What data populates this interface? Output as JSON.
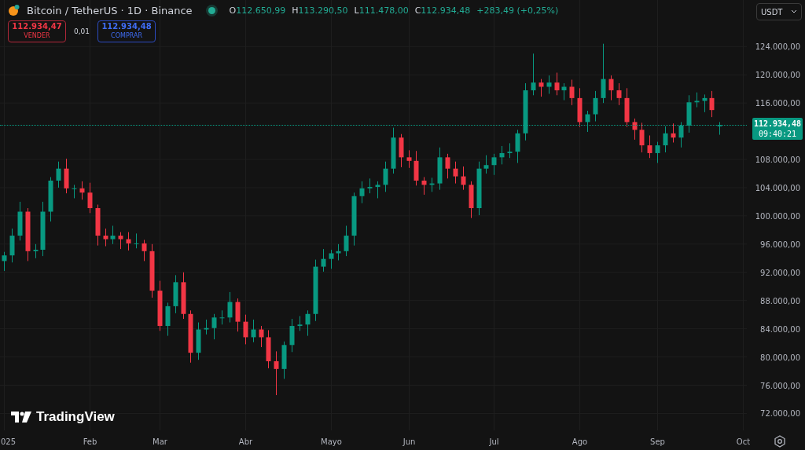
{
  "legend": {
    "title": "Bitcoin / TetherUS · 1D · Binance",
    "market_open": true,
    "ohlc": [
      {
        "label": "O",
        "value": "112.650,99"
      },
      {
        "label": "H",
        "value": "113.290,50"
      },
      {
        "label": "L",
        "value": "111.478,00"
      },
      {
        "label": "C",
        "value": "112.934,48"
      }
    ],
    "change": "+283,49 (+0,25%)"
  },
  "trade": {
    "sell": {
      "price": "112.934,47",
      "label": "VENDER"
    },
    "spread": "0,01",
    "buy": {
      "price": "112.934,48",
      "label": "COMPRAR"
    }
  },
  "currency": "USDT",
  "last_price": {
    "price": "112.934,48",
    "countdown": "09:40:21"
  },
  "logo": "TradingView",
  "chart_data": {
    "type": "candlestick",
    "grid": true,
    "ylim": [
      69600,
      130600
    ],
    "categories": [
      "025",
      null,
      null,
      null,
      null,
      null,
      null,
      null,
      null,
      null,
      null,
      "Feb",
      null,
      null,
      null,
      null,
      null,
      null,
      null,
      null,
      "Mar",
      null,
      null,
      null,
      null,
      null,
      null,
      null,
      null,
      null,
      null,
      "Abr",
      null,
      null,
      null,
      null,
      null,
      null,
      null,
      null,
      null,
      null,
      "Mayo",
      null,
      null,
      null,
      null,
      null,
      null,
      null,
      null,
      null,
      "Jun",
      null,
      null,
      null,
      null,
      null,
      null,
      null,
      null,
      null,
      null,
      "Jul",
      null,
      null,
      null,
      null,
      null,
      null,
      null,
      null,
      null,
      null,
      "Ago",
      null,
      null,
      null,
      null,
      null,
      null,
      null,
      null,
      null,
      "Sep",
      null,
      null,
      null,
      null,
      null,
      null,
      null,
      null,
      null,
      null,
      "Oct"
    ],
    "ohlc": [
      [
        93600,
        94900,
        92200,
        94400
      ],
      [
        94400,
        98200,
        93400,
        97200
      ],
      [
        97200,
        102000,
        96500,
        100600
      ],
      [
        100600,
        101100,
        93600,
        95000
      ],
      [
        95000,
        96000,
        94000,
        95200
      ],
      [
        95200,
        102000,
        94300,
        100600
      ],
      [
        100600,
        105500,
        99200,
        105000
      ],
      [
        105000,
        107700,
        104000,
        106700
      ],
      [
        106700,
        108100,
        103200,
        103900
      ],
      [
        103900,
        104400,
        102500,
        103900
      ],
      [
        103900,
        104900,
        102300,
        103300
      ],
      [
        103300,
        104700,
        100400,
        101100
      ],
      [
        101100,
        101600,
        95800,
        97200
      ],
      [
        97200,
        98200,
        95700,
        96700
      ],
      [
        96700,
        98600,
        96000,
        97200
      ],
      [
        97200,
        97700,
        95300,
        96700
      ],
      [
        96700,
        97700,
        95100,
        96100
      ],
      [
        96100,
        97500,
        95400,
        96100
      ],
      [
        96100,
        96600,
        93600,
        95000
      ],
      [
        95000,
        96000,
        88400,
        89400
      ],
      [
        89400,
        90800,
        83700,
        84400
      ],
      [
        84400,
        87700,
        83000,
        87200
      ],
      [
        87200,
        91600,
        86200,
        90600
      ],
      [
        90600,
        92000,
        85400,
        86100
      ],
      [
        86100,
        86600,
        79200,
        80600
      ],
      [
        80600,
        84900,
        79600,
        83900
      ],
      [
        83900,
        85300,
        83200,
        84100
      ],
      [
        84100,
        86100,
        82500,
        85600
      ],
      [
        85600,
        86600,
        84600,
        85600
      ],
      [
        85600,
        89200,
        84900,
        87800
      ],
      [
        87800,
        88300,
        83600,
        85000
      ],
      [
        85000,
        86000,
        81800,
        82800
      ],
      [
        82800,
        85300,
        82100,
        83900
      ],
      [
        83900,
        84400,
        81400,
        82800
      ],
      [
        82800,
        83800,
        78400,
        79400
      ],
      [
        79400,
        80800,
        74600,
        78300
      ],
      [
        78300,
        82200,
        76900,
        81700
      ],
      [
        81700,
        85400,
        80700,
        84400
      ],
      [
        84400,
        85800,
        83700,
        84600
      ],
      [
        84600,
        86600,
        83000,
        86100
      ],
      [
        86100,
        93800,
        85100,
        92800
      ],
      [
        92800,
        95300,
        92100,
        93900
      ],
      [
        93900,
        95200,
        92500,
        94700
      ],
      [
        94700,
        96000,
        93700,
        95000
      ],
      [
        95000,
        98600,
        94300,
        97200
      ],
      [
        97200,
        103300,
        95800,
        102800
      ],
      [
        102800,
        104900,
        101800,
        103900
      ],
      [
        103900,
        105300,
        103200,
        104100
      ],
      [
        104100,
        104900,
        102500,
        104400
      ],
      [
        104400,
        107700,
        103400,
        106700
      ],
      [
        106700,
        112500,
        106000,
        111100
      ],
      [
        111100,
        111600,
        106900,
        108300
      ],
      [
        108300,
        109300,
        106800,
        107800
      ],
      [
        107800,
        109200,
        104300,
        105000
      ],
      [
        105000,
        105500,
        103000,
        104400
      ],
      [
        104400,
        105400,
        103400,
        104600
      ],
      [
        104600,
        109700,
        103700,
        108300
      ],
      [
        108300,
        108800,
        105300,
        106700
      ],
      [
        106700,
        107700,
        104600,
        105600
      ],
      [
        105600,
        107000,
        103700,
        104400
      ],
      [
        104400,
        104900,
        99700,
        101100
      ],
      [
        101100,
        107700,
        100100,
        106700
      ],
      [
        106700,
        108600,
        106000,
        107200
      ],
      [
        107200,
        108800,
        105800,
        108300
      ],
      [
        108300,
        109900,
        107300,
        108900
      ],
      [
        108900,
        110300,
        108200,
        109100
      ],
      [
        109100,
        112200,
        107500,
        111700
      ],
      [
        111700,
        118800,
        110700,
        117800
      ],
      [
        117800,
        123000,
        117100,
        118900
      ],
      [
        118900,
        119400,
        116900,
        118300
      ],
      [
        118300,
        119900,
        117300,
        118900
      ],
      [
        118900,
        120300,
        117100,
        117800
      ],
      [
        117800,
        118800,
        116400,
        118300
      ],
      [
        118300,
        119300,
        115700,
        116700
      ],
      [
        116700,
        118100,
        112600,
        113300
      ],
      [
        113300,
        114900,
        111900,
        114400
      ],
      [
        114400,
        117700,
        113400,
        116700
      ],
      [
        116700,
        124400,
        116000,
        119400
      ],
      [
        119400,
        119900,
        116400,
        117800
      ],
      [
        117800,
        118800,
        115700,
        116700
      ],
      [
        116700,
        118100,
        112600,
        113300
      ],
      [
        113300,
        113800,
        110800,
        112200
      ],
      [
        112200,
        113200,
        109000,
        110000
      ],
      [
        110000,
        111400,
        108200,
        108900
      ],
      [
        108900,
        110500,
        107500,
        110000
      ],
      [
        110000,
        112700,
        109000,
        111700
      ],
      [
        111700,
        113100,
        110400,
        111100
      ],
      [
        111100,
        113300,
        109700,
        112800
      ],
      [
        112800,
        117100,
        111800,
        116100
      ],
      [
        116100,
        117500,
        115400,
        116300
      ],
      [
        116300,
        117200,
        114700,
        116700
      ],
      [
        116700,
        117700,
        114000,
        115000
      ],
      [
        112700,
        113300,
        111500,
        112900
      ],
      null,
      null,
      null
    ],
    "yticks": [
      {
        "value": 124000,
        "label": "124.000,00"
      },
      {
        "value": 120000,
        "label": "120.000,00"
      },
      {
        "value": 116000,
        "label": "116.000,00"
      },
      {
        "value": 108000,
        "label": "108.000,00"
      },
      {
        "value": 104000,
        "label": "104.000,00"
      },
      {
        "value": 100000,
        "label": "100.000,00"
      },
      {
        "value": 96000,
        "label": "96.000,00"
      },
      {
        "value": 92000,
        "label": "92.000,00"
      },
      {
        "value": 88000,
        "label": "88.000,00"
      },
      {
        "value": 84000,
        "label": "84.000,00"
      },
      {
        "value": 80000,
        "label": "80.000,00"
      },
      {
        "value": 76000,
        "label": "76.000,00"
      },
      {
        "value": 72000,
        "label": "72.000,00"
      }
    ]
  }
}
